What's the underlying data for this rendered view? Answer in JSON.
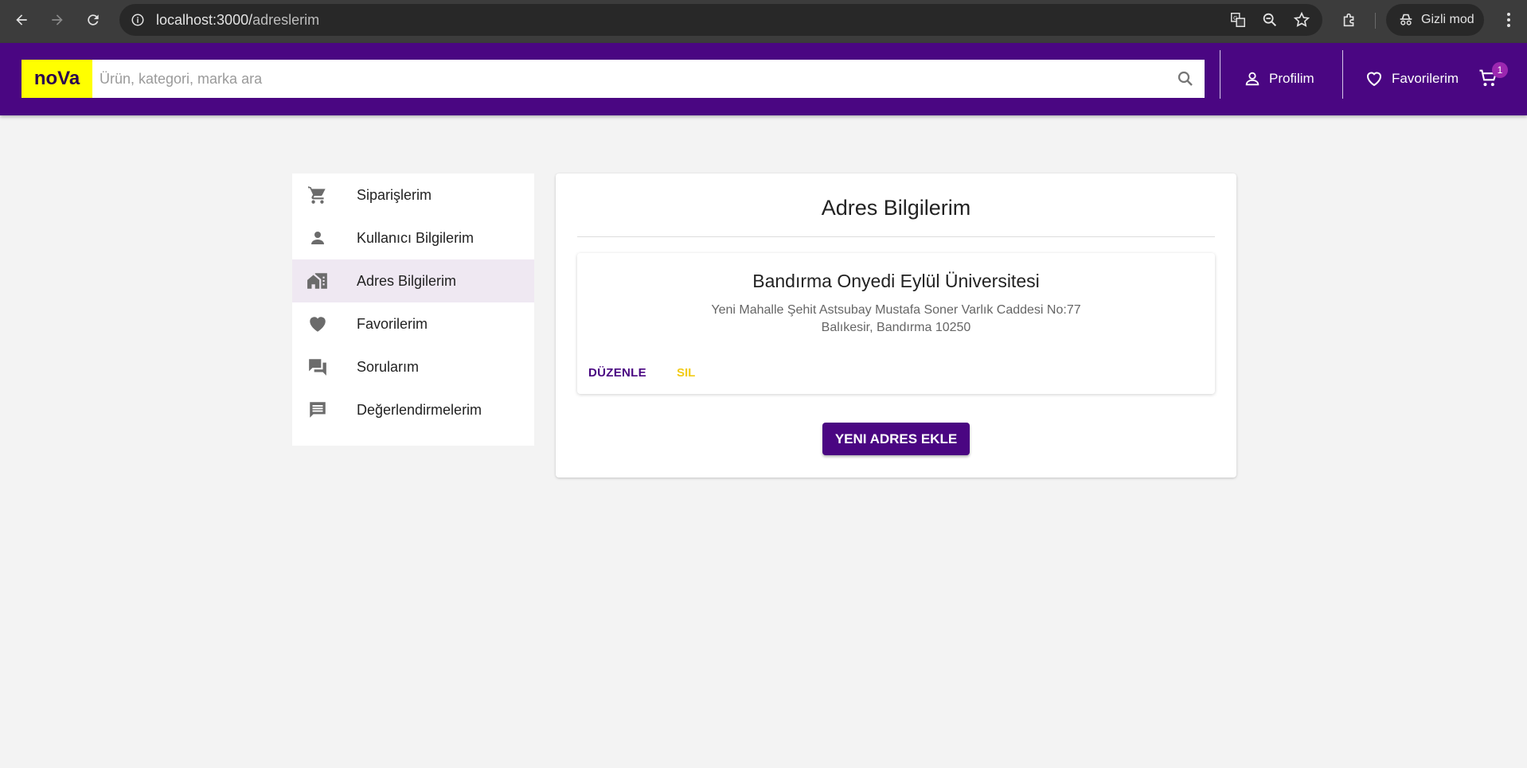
{
  "browser": {
    "url_host": "localhost:3000/",
    "url_path": "adreslerim",
    "incognito_label": "Gizli mod"
  },
  "header": {
    "logo": "noVa",
    "search_placeholder": "Ürün, kategori, marka ara",
    "profile_label": "Profilim",
    "favorites_label": "Favorilerim",
    "cart_count": "1",
    "colors": {
      "bar": "#4a0682",
      "logo_bg": "#ffff00"
    }
  },
  "sidebar": {
    "items": [
      {
        "label": "Siparişlerim",
        "icon": "cart-icon"
      },
      {
        "label": "Kullanıcı Bilgilerim",
        "icon": "person-icon"
      },
      {
        "label": "Adres Bilgilerim",
        "icon": "home-icon",
        "active": true
      },
      {
        "label": "Favorilerim",
        "icon": "heart-icon"
      },
      {
        "label": "Sorularım",
        "icon": "forum-icon"
      },
      {
        "label": "Değerlendirmelerim",
        "icon": "comment-icon"
      }
    ]
  },
  "main": {
    "title": "Adres Bilgilerim",
    "address": {
      "title": "Bandırma Onyedi Eylül Üniversitesi",
      "line1": "Yeni Mahalle Şehit Astsubay Mustafa Soner Varlık Caddesi No:77",
      "line2": "Balıkesir, Bandırma 10250",
      "edit_label": "DÜZENLE",
      "delete_label": "SIL"
    },
    "new_address_label": "YENI ADRES EKLE"
  }
}
